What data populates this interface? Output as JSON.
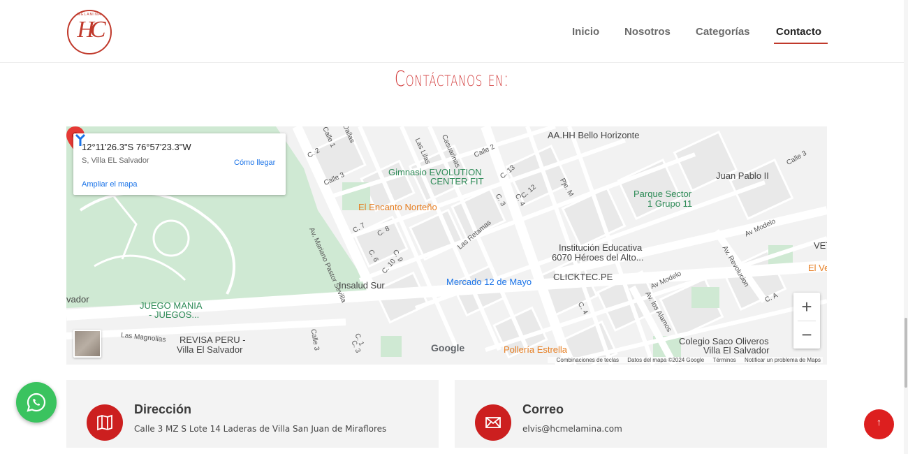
{
  "header": {
    "logo_text": "HC",
    "logo_arc": "MELAMINA",
    "nav": [
      {
        "label": "Inicio"
      },
      {
        "label": "Nosotros"
      },
      {
        "label": "Categorías"
      },
      {
        "label": "Contacto"
      }
    ],
    "active_nav": "Contacto"
  },
  "page_title": "Contáctanos en:",
  "map": {
    "coords": "12°11'26.3\"S 76°57'23.3\"W",
    "address": "S, Villa EL Salvador",
    "directions_label": "Cómo llegar",
    "expand_link": "Ampliar el mapa",
    "zoom_in": "+",
    "zoom_out": "−",
    "google": "Google",
    "attribution": [
      "Combinaciones de teclas",
      "Datos del mapa ©2024 Google",
      "Términos",
      "Notificar un problema de Maps"
    ],
    "places": {
      "bello_horizonte": "AA.HH Bello Horizonte",
      "gimnasio1": "Gimnasio EVOLUTION",
      "gimnasio2": "CENTER FIT",
      "juan_pablo": "Juan Pablo II",
      "parque1": "Parque Sector",
      "parque2": "1 Grupo 11",
      "encanto": "El Encanto Norteño",
      "institucion1": "Institución Educativa",
      "institucion2": "6070 Héroes del Alto...",
      "insalud": "Insalud Sur",
      "mercado": "Mercado 12 de Mayo",
      "clicktec": "CLICKTEC.PE",
      "juego1": "JUEGO MANIA",
      "juego2": "- JUEGOS...",
      "revisa1": "REVISA PERU -",
      "revisa2": "Villa El Salvador",
      "polleria": "Pollería Estrella",
      "colegio1": "Colegio Saco Oliveros",
      "colegio2": "Villa El Salvador",
      "vet": "VET",
      "elve": "El Ve",
      "vador": "vador"
    },
    "streets": {
      "av_mariano": "Av. Mariano Pastor Sevilla",
      "av_modelo": "Av Modelo",
      "av_modelo2": "Av Modelo",
      "av_revolucion": "Av. Revolucion",
      "av_alamos": "Av. los Alamos",
      "las_retamas": "Las Retamas",
      "las_magnolias": "Las Magnolias",
      "calle3": "Calle 3",
      "calle2": "C. 2",
      "c7": "C. 7",
      "c8": "C. 8",
      "c6": "C. 6",
      "c10": "C. 10",
      "c9": "C. 9",
      "c13": "C. 13",
      "c12": "C. 12",
      "c3": "C. 3",
      "c4": "C. 4",
      "pjem": "Pje. M",
      "calle2b": "Calle 2",
      "casuarinas": "Casuarinas",
      "laslilas": "Las Lilas",
      "calle1": "Calle 1",
      "dallas": "Dallas",
      "c4b": "C. 4",
      "ca": "C. A",
      "calle3b": "Calle 3",
      "c1": "C. 1",
      "c3b": "C. 3",
      "calle3c": "Calle 3"
    }
  },
  "contact": {
    "address_title": "Dirección",
    "address_text": "Calle 3 MZ S Lote 14 Laderas de Villa San Juan de Miraflores",
    "email_title": "Correo",
    "email_text": "elvis@hcmelamina.com"
  },
  "to_top_label": "↑",
  "colors": {
    "accent": "#cc1f1f",
    "title_red": "#d23a3a",
    "whatsapp": "#3ac35f",
    "card_bg": "#f3f3f3"
  }
}
